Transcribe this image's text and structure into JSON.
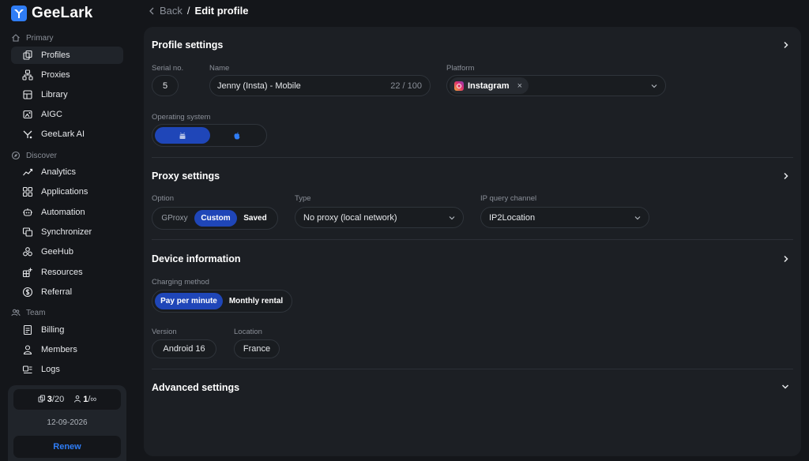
{
  "app": {
    "name": "GeeLark",
    "accent": "#2f7df6"
  },
  "sidebar": {
    "primary_label": "Primary",
    "primary_items": [
      {
        "label": "Profiles",
        "icon": "profiles-icon",
        "active": true
      },
      {
        "label": "Proxies",
        "icon": "proxies-icon"
      },
      {
        "label": "Library",
        "icon": "library-icon"
      },
      {
        "label": "AIGC",
        "icon": "aigc-icon"
      },
      {
        "label": "GeeLark AI",
        "icon": "geelark-ai-icon"
      }
    ],
    "discover_label": "Discover",
    "discover_items": [
      {
        "label": "Analytics",
        "icon": "analytics-icon"
      },
      {
        "label": "Applications",
        "icon": "applications-icon"
      },
      {
        "label": "Automation",
        "icon": "automation-icon"
      },
      {
        "label": "Synchronizer",
        "icon": "synchronizer-icon"
      },
      {
        "label": "GeeHub",
        "icon": "geehub-icon"
      },
      {
        "label": "Resources",
        "icon": "resources-icon"
      },
      {
        "label": "Referral",
        "icon": "referral-icon"
      }
    ],
    "team_label": "Team",
    "team_items": [
      {
        "label": "Billing",
        "icon": "billing-icon"
      },
      {
        "label": "Members",
        "icon": "members-icon"
      },
      {
        "label": "Logs",
        "icon": "logs-icon"
      }
    ],
    "plan": {
      "profiles_used": "3",
      "profiles_total": "/20",
      "members_used": "1",
      "members_total": "/∞",
      "date": "12-09-2026",
      "renew_label": "Renew"
    }
  },
  "header": {
    "back_label": "Back",
    "separator": "/",
    "title": "Edit profile"
  },
  "profile_settings": {
    "title": "Profile settings",
    "serial_label": "Serial no.",
    "serial_value": "5",
    "name_label": "Name",
    "name_value": "Jenny (Insta) - Mobile",
    "name_counter": "22 / 100",
    "platform_label": "Platform",
    "platform_value": "Instagram",
    "platform_remove": "×",
    "os_label": "Operating system",
    "os_options": [
      "android",
      "ios"
    ],
    "os_selected": "android"
  },
  "proxy_settings": {
    "title": "Proxy settings",
    "option_label": "Option",
    "options": [
      "GProxy",
      "Custom",
      "Saved"
    ],
    "option_selected": "Custom",
    "type_label": "Type",
    "type_value": "No proxy (local network)",
    "ip_channel_label": "IP query channel",
    "ip_channel_value": "IP2Location"
  },
  "device_info": {
    "title": "Device information",
    "charging_label": "Charging method",
    "charging_options": [
      "Pay per minute",
      "Monthly rental"
    ],
    "charging_selected": "Pay per minute",
    "version_label": "Version",
    "version_value": "Android 16",
    "location_label": "Location",
    "location_value": "France"
  },
  "advanced_settings": {
    "title": "Advanced settings"
  }
}
